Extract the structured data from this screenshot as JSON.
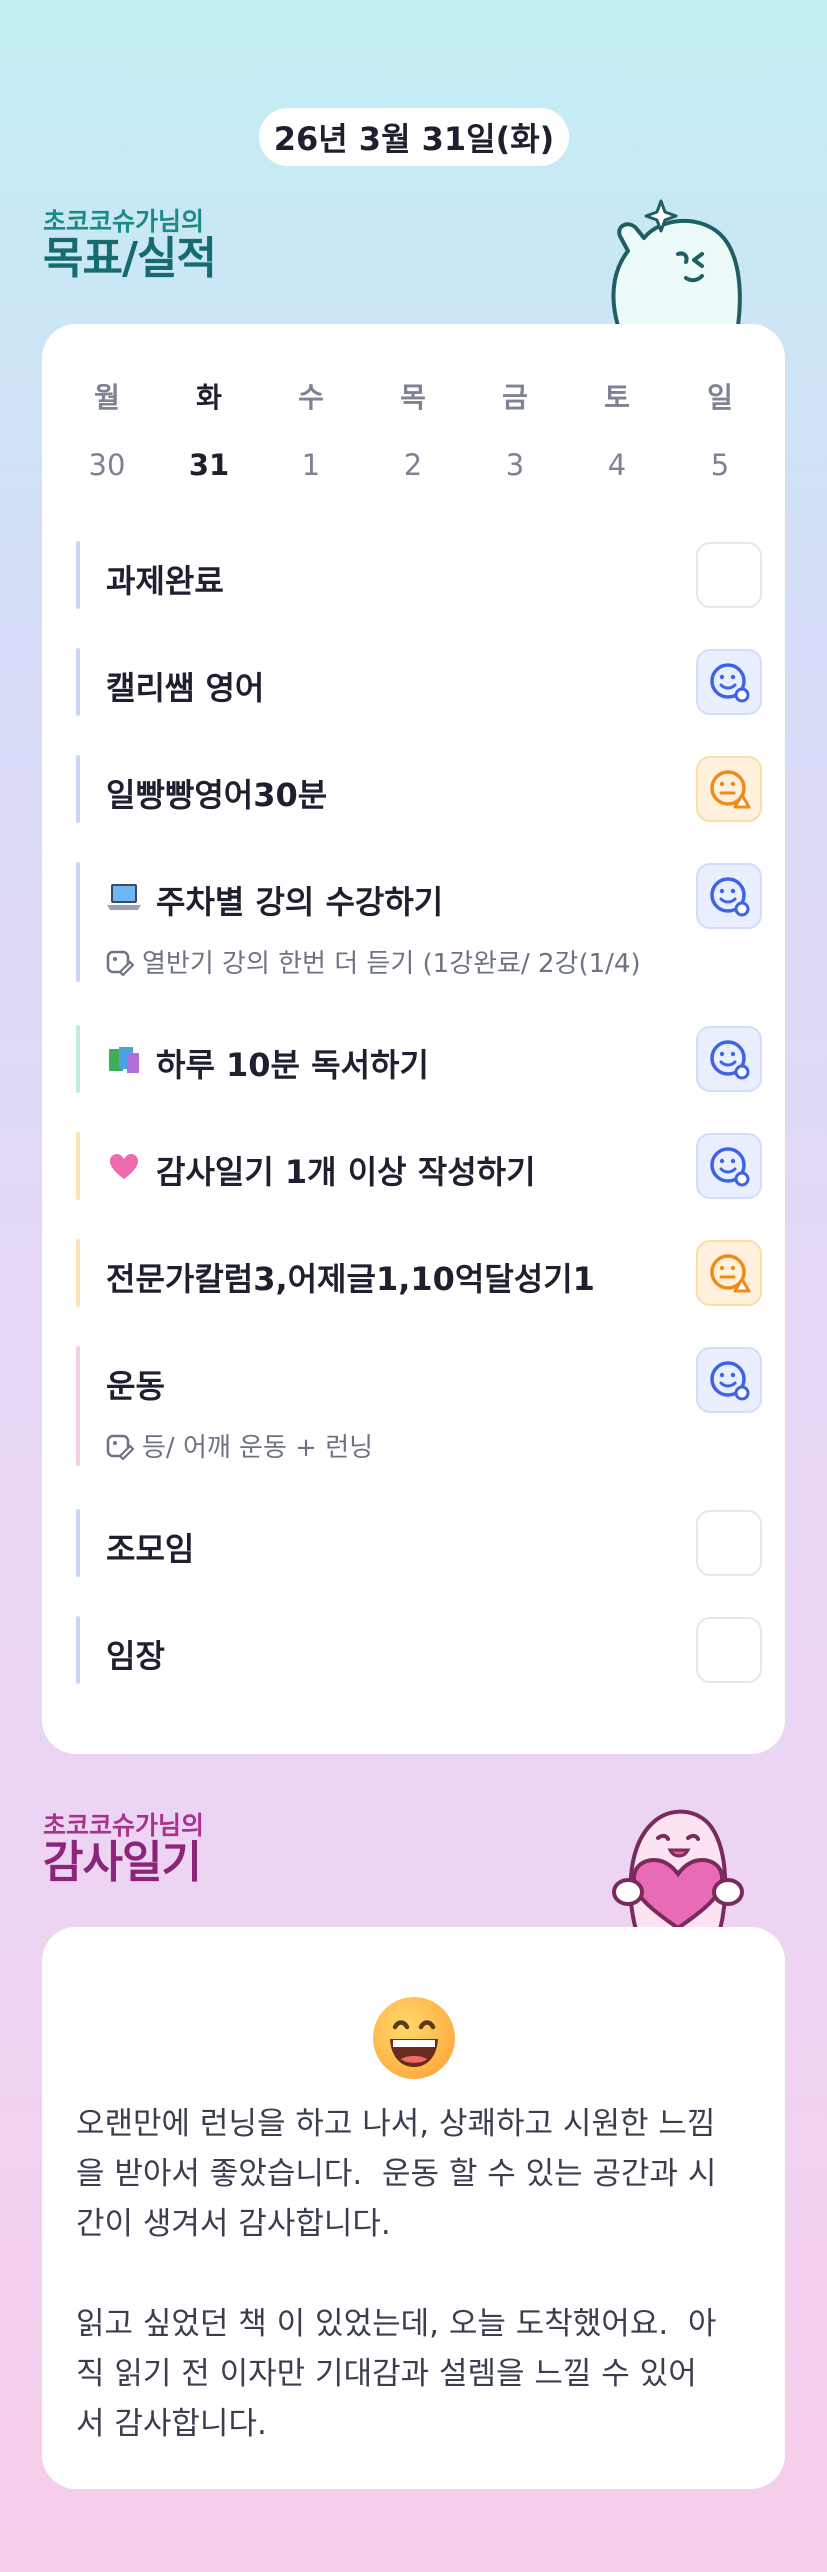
{
  "date": "26년 3월 31일(화)",
  "goal_section": {
    "owner": "초코코슈가님의",
    "title": "목표/실적"
  },
  "week": {
    "days": [
      "월",
      "화",
      "수",
      "목",
      "금",
      "토",
      "일"
    ],
    "dates": [
      "30",
      "31",
      "1",
      "2",
      "3",
      "4",
      "5"
    ],
    "active_index": 1
  },
  "tasks": [
    {
      "title": "과제완료",
      "status": "empty",
      "bar_color": "#c9d4f6"
    },
    {
      "title": "캘리쌤 영어",
      "status": "good",
      "bar_color": "#c9d4f6"
    },
    {
      "title": "일빵빵영어30분",
      "status": "meh",
      "bar_color": "#c9d4f6"
    },
    {
      "title": "주차별 강의 수강하기",
      "icon": "laptop-icon",
      "sub": "열반기 강의 한번 더 듣기 (1강완료/ 2강(1/4)",
      "status": "good",
      "bar_color": "#c9d4f6"
    },
    {
      "title": "하루 10분 독서하기",
      "icon": "books-icon",
      "status": "good",
      "bar_color": "#bfeedd"
    },
    {
      "title": "감사일기 1개 이상 작성하기",
      "icon": "heart-icon",
      "status": "good",
      "bar_color": "#fde2b8"
    },
    {
      "title": "전문가칼럼3,어제글1,10억달성기1",
      "status": "meh",
      "bar_color": "#fde2b8"
    },
    {
      "title": "운동",
      "sub": "등/ 어깨 운동 + 런닝",
      "status": "good",
      "bar_color": "#f7cde6"
    },
    {
      "title": "조모임",
      "status": "empty",
      "bar_color": "#c9d4f6"
    },
    {
      "title": "임장",
      "status": "empty",
      "bar_color": "#c9d4f6"
    }
  ],
  "thanks_section": {
    "owner": "초코코슈가님의",
    "title": "감사일기",
    "emoji": "grinning-face-icon",
    "text": "오랜만에 런닝을 하고 나서, 상쾌하고 시원한 느낌\n을 받아서 좋았습니다.  운동 할 수 있는 공간과 시\n간이 생겨서 감사합니다.\n\n읽고 싶었던 책 이 있었는데, 오늘 도착했어요.  아\n직 읽기 전 이자만 기대감과 설렘을 느낄 수 있어\n서 감사합니다."
  },
  "colors": {
    "goal_title": "#156b6f",
    "thanks_title": "#8c2479",
    "good_icon": "#3d63e6",
    "meh_icon": "#f08a1c"
  }
}
